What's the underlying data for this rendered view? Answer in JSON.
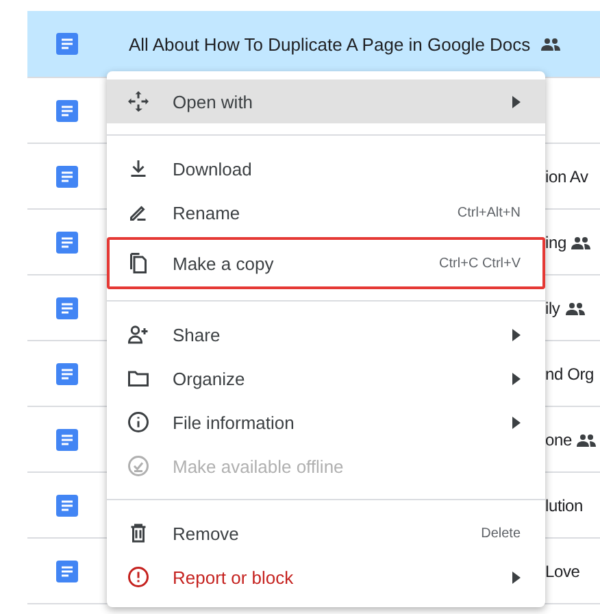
{
  "header_row": {
    "title": "All About How To Duplicate A Page in Google Docs",
    "shared": true,
    "selected": true
  },
  "file_rows": [
    {},
    {
      "title": "ion Av"
    },
    {
      "title": "ing",
      "shared": true
    },
    {
      "title": "ily",
      "shared": true
    },
    {
      "title": "nd Org"
    },
    {
      "title": "one",
      "shared": true
    },
    {
      "title": "lution"
    },
    {
      "title": "Love"
    }
  ],
  "context_menu": {
    "items": [
      {
        "kind": "item",
        "label": "Open with",
        "submenu": true,
        "hovered": true,
        "outlined": false,
        "disabled": false,
        "danger": false
      },
      {
        "kind": "divider"
      },
      {
        "kind": "item",
        "label": "Download",
        "submenu": false,
        "hovered": false,
        "outlined": false,
        "disabled": false,
        "danger": false
      },
      {
        "kind": "item",
        "label": "Rename",
        "shortcut": "Ctrl+Alt+N",
        "submenu": false,
        "hovered": false,
        "outlined": false,
        "disabled": false,
        "danger": false
      },
      {
        "kind": "item",
        "label": "Make a copy",
        "shortcut": "Ctrl+C Ctrl+V",
        "submenu": false,
        "hovered": false,
        "outlined": true,
        "disabled": false,
        "danger": false
      },
      {
        "kind": "divider"
      },
      {
        "kind": "item",
        "label": "Share",
        "submenu": true,
        "hovered": false,
        "outlined": false,
        "disabled": false,
        "danger": false
      },
      {
        "kind": "item",
        "label": "Organize",
        "submenu": true,
        "hovered": false,
        "outlined": false,
        "disabled": false,
        "danger": false
      },
      {
        "kind": "item",
        "label": "File information",
        "submenu": true,
        "hovered": false,
        "outlined": false,
        "disabled": false,
        "danger": false
      },
      {
        "kind": "item",
        "label": "Make available offline",
        "submenu": false,
        "hovered": false,
        "outlined": false,
        "disabled": true,
        "danger": false
      },
      {
        "kind": "divider"
      },
      {
        "kind": "item",
        "label": "Remove",
        "shortcut": "Delete",
        "submenu": false,
        "hovered": false,
        "outlined": false,
        "disabled": false,
        "danger": false
      },
      {
        "kind": "item",
        "label": "Report or block",
        "submenu": true,
        "hovered": false,
        "outlined": false,
        "disabled": false,
        "danger": true
      }
    ]
  }
}
